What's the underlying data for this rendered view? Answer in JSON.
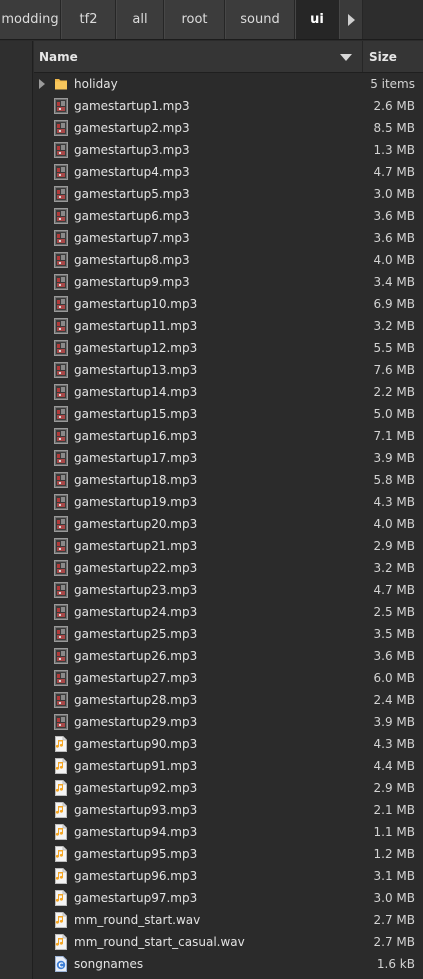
{
  "breadcrumbs": [
    {
      "label": "modding",
      "active": false
    },
    {
      "label": "tf2",
      "active": false
    },
    {
      "label": "all",
      "active": false
    },
    {
      "label": "root",
      "active": false
    },
    {
      "label": "sound",
      "active": false
    },
    {
      "label": "ui",
      "active": true
    }
  ],
  "columns": {
    "name": "Name",
    "size": "Size"
  },
  "files": [
    {
      "name": "holiday",
      "size": "5 items",
      "type": "folder"
    },
    {
      "name": "gamestartup1.mp3",
      "size": "2.6 MB",
      "type": "audio-thumb"
    },
    {
      "name": "gamestartup2.mp3",
      "size": "8.5 MB",
      "type": "audio-thumb"
    },
    {
      "name": "gamestartup3.mp3",
      "size": "1.3 MB",
      "type": "audio-thumb"
    },
    {
      "name": "gamestartup4.mp3",
      "size": "4.7 MB",
      "type": "audio-thumb"
    },
    {
      "name": "gamestartup5.mp3",
      "size": "3.0 MB",
      "type": "audio-thumb"
    },
    {
      "name": "gamestartup6.mp3",
      "size": "3.6 MB",
      "type": "audio-thumb"
    },
    {
      "name": "gamestartup7.mp3",
      "size": "3.6 MB",
      "type": "audio-thumb"
    },
    {
      "name": "gamestartup8.mp3",
      "size": "4.0 MB",
      "type": "audio-thumb"
    },
    {
      "name": "gamestartup9.mp3",
      "size": "3.4 MB",
      "type": "audio-thumb"
    },
    {
      "name": "gamestartup10.mp3",
      "size": "6.9 MB",
      "type": "audio-thumb"
    },
    {
      "name": "gamestartup11.mp3",
      "size": "3.2 MB",
      "type": "audio-thumb"
    },
    {
      "name": "gamestartup12.mp3",
      "size": "5.5 MB",
      "type": "audio-thumb"
    },
    {
      "name": "gamestartup13.mp3",
      "size": "7.6 MB",
      "type": "audio-thumb"
    },
    {
      "name": "gamestartup14.mp3",
      "size": "2.2 MB",
      "type": "audio-thumb"
    },
    {
      "name": "gamestartup15.mp3",
      "size": "5.0 MB",
      "type": "audio-thumb"
    },
    {
      "name": "gamestartup16.mp3",
      "size": "7.1 MB",
      "type": "audio-thumb"
    },
    {
      "name": "gamestartup17.mp3",
      "size": "3.9 MB",
      "type": "audio-thumb"
    },
    {
      "name": "gamestartup18.mp3",
      "size": "5.8 MB",
      "type": "audio-thumb"
    },
    {
      "name": "gamestartup19.mp3",
      "size": "4.3 MB",
      "type": "audio-thumb"
    },
    {
      "name": "gamestartup20.mp3",
      "size": "4.0 MB",
      "type": "audio-thumb"
    },
    {
      "name": "gamestartup21.mp3",
      "size": "2.9 MB",
      "type": "audio-thumb"
    },
    {
      "name": "gamestartup22.mp3",
      "size": "3.2 MB",
      "type": "audio-thumb"
    },
    {
      "name": "gamestartup23.mp3",
      "size": "4.7 MB",
      "type": "audio-thumb"
    },
    {
      "name": "gamestartup24.mp3",
      "size": "2.5 MB",
      "type": "audio-thumb"
    },
    {
      "name": "gamestartup25.mp3",
      "size": "3.5 MB",
      "type": "audio-thumb"
    },
    {
      "name": "gamestartup26.mp3",
      "size": "3.6 MB",
      "type": "audio-thumb"
    },
    {
      "name": "gamestartup27.mp3",
      "size": "6.0 MB",
      "type": "audio-thumb"
    },
    {
      "name": "gamestartup28.mp3",
      "size": "2.4 MB",
      "type": "audio-thumb"
    },
    {
      "name": "gamestartup29.mp3",
      "size": "3.9 MB",
      "type": "audio-thumb"
    },
    {
      "name": "gamestartup90.mp3",
      "size": "4.3 MB",
      "type": "audio"
    },
    {
      "name": "gamestartup91.mp3",
      "size": "4.4 MB",
      "type": "audio"
    },
    {
      "name": "gamestartup92.mp3",
      "size": "2.9 MB",
      "type": "audio"
    },
    {
      "name": "gamestartup93.mp3",
      "size": "2.1 MB",
      "type": "audio"
    },
    {
      "name": "gamestartup94.mp3",
      "size": "1.1 MB",
      "type": "audio"
    },
    {
      "name": "gamestartup95.mp3",
      "size": "1.2 MB",
      "type": "audio"
    },
    {
      "name": "gamestartup96.mp3",
      "size": "3.1 MB",
      "type": "audio"
    },
    {
      "name": "gamestartup97.mp3",
      "size": "3.0 MB",
      "type": "audio"
    },
    {
      "name": "mm_round_start.wav",
      "size": "2.7 MB",
      "type": "audio"
    },
    {
      "name": "mm_round_start_casual.wav",
      "size": "2.7 MB",
      "type": "audio"
    },
    {
      "name": "songnames",
      "size": "1.6 kB",
      "type": "c-source"
    }
  ],
  "colors": {
    "background": "#2b2b2b",
    "folder": "#f0b84a",
    "audio_note": "#f5a623",
    "c_source": "#3e7fd6"
  }
}
